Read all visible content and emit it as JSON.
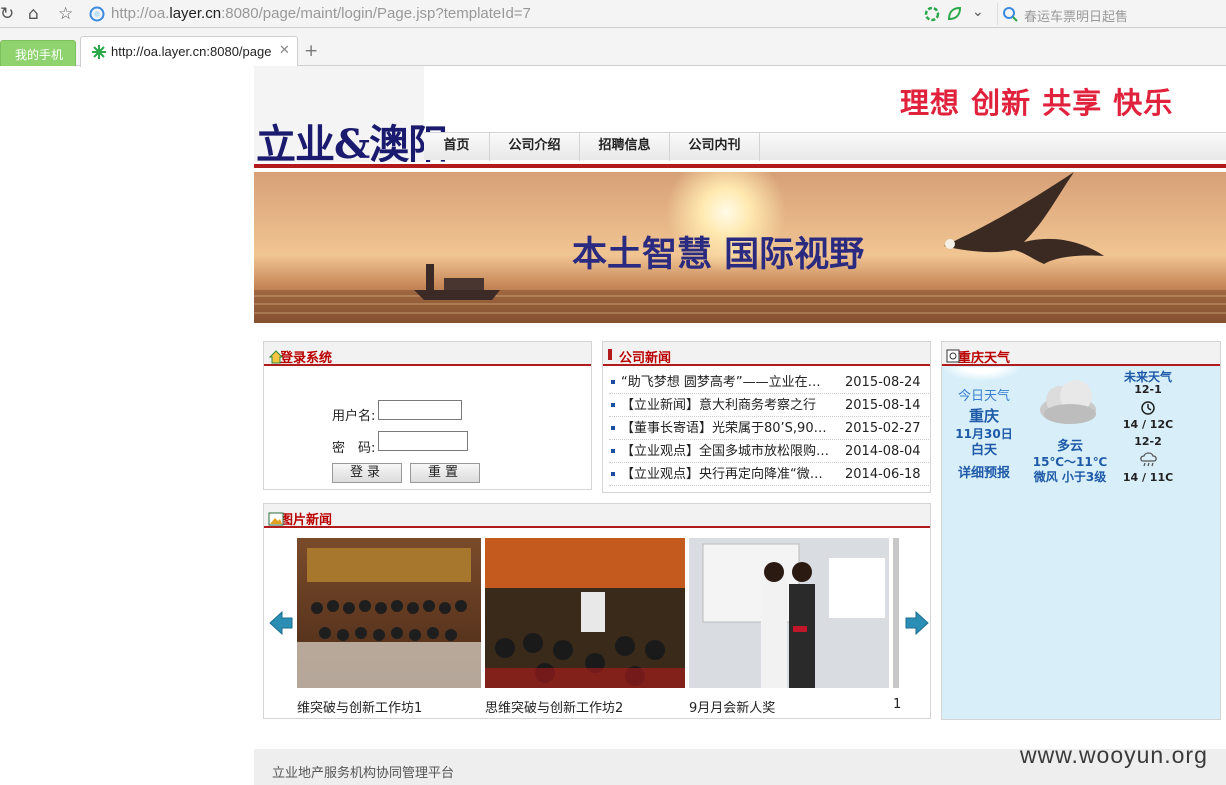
{
  "browser": {
    "url": "http://oa.layer.cn:8080/page/maint/login/Page.jsp?templateId=7",
    "url_prefix": "http://oa.",
    "url_host": "layer.cn",
    "url_suffix": ":8080/page/maint/login/Page.jsp?templateId=7",
    "search_placeholder": "春运车票明日起售",
    "tabs": [
      {
        "label": "我的手机"
      },
      {
        "label": "http://oa.layer.cn:8080/page"
      }
    ],
    "new_tab": "+"
  },
  "site": {
    "logo": "立业&澳阳",
    "slogan": "理想 创新 共享 快乐",
    "nav": [
      "首页",
      "公司介绍",
      "招聘信息",
      "公司内刊"
    ],
    "banner_text": "本土智慧 国际视野"
  },
  "login": {
    "title": "登录系统",
    "username_label": "用户名:",
    "password_label": "密　码:",
    "username_value": "",
    "password_value": "",
    "login_button": "登录",
    "reset_button": "重置"
  },
  "company_news": {
    "title": "公司新闻",
    "items": [
      {
        "title": "“助飞梦想 圆梦高考”——立业在…",
        "date": "2015-08-24"
      },
      {
        "title": "【立业新闻】意大利商务考察之行",
        "date": "2015-08-14"
      },
      {
        "title": "【董事长寄语】光荣属于80’S,90…",
        "date": "2015-02-27"
      },
      {
        "title": "【立业观点】全国多城市放松限购…",
        "date": "2014-08-04"
      },
      {
        "title": "【立业观点】央行再定向降准“微…",
        "date": "2014-06-18"
      }
    ]
  },
  "weather": {
    "title": "重庆天气",
    "today_label": "今日天气",
    "city": "重庆",
    "date": "11月30日",
    "period": "白天",
    "detail_link": "详细预报",
    "condition": "多云",
    "temp": "15℃～11℃",
    "wind": "微风 小于3级",
    "future_label": "未来天气",
    "forecast": [
      {
        "date": "12-1",
        "temp": "14 / 12C",
        "icon": "clock-icon"
      },
      {
        "date": "12-2",
        "temp": "14 / 11C",
        "icon": "rain-cloud-icon"
      }
    ]
  },
  "photo_news": {
    "title": "图片新闻",
    "items": [
      {
        "caption": "维突破与创新工作坊1"
      },
      {
        "caption": "思维突破与创新工作坊2"
      },
      {
        "caption": "9月月会新人奖"
      },
      {
        "caption": "1"
      }
    ]
  },
  "footer": {
    "text": "立业地产服务机构协同管理平台"
  },
  "watermark": "www.wooyun.org",
  "colors": {
    "slogan": "#e0223c",
    "logo": "#1a1a6e",
    "accent_red": "#b21b1b",
    "weather_bg": "#d8effa"
  }
}
